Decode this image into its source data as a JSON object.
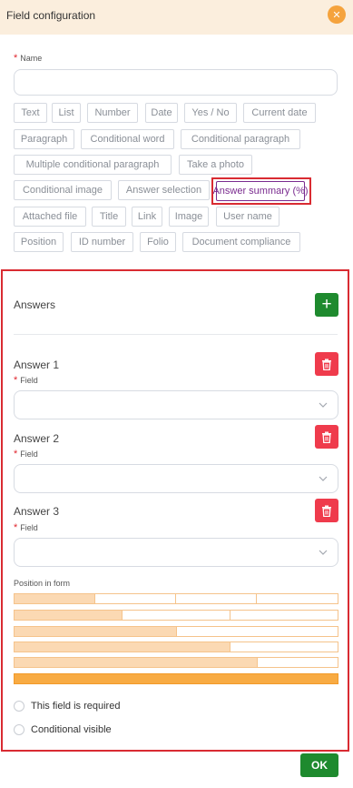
{
  "header": {
    "title": "Field configuration",
    "close_glyph": "✕"
  },
  "name_field": {
    "label": "Name",
    "value": "",
    "placeholder": ""
  },
  "field_types": [
    "Text",
    "List",
    "Number",
    "Date",
    "Yes / No",
    "Current date",
    "Paragraph",
    "Conditional word",
    "Conditional paragraph",
    "Multiple conditional paragraph",
    "Take a photo",
    "Conditional image",
    "Answer selection",
    "Answer summary (%)",
    "Attached file",
    "Title",
    "Link",
    "Image",
    "User name",
    "Position",
    "ID number",
    "Folio",
    "Document compliance"
  ],
  "selected_field_type": "Answer summary (%)",
  "answers": {
    "title": "Answers",
    "add_glyph": "+",
    "items": [
      {
        "label": "Answer 1",
        "field_label": "Field",
        "value": ""
      },
      {
        "label": "Answer 2",
        "field_label": "Field",
        "value": ""
      },
      {
        "label": "Answer 3",
        "field_label": "Field",
        "value": ""
      }
    ]
  },
  "position": {
    "label": "Position in form"
  },
  "options": {
    "required_label": "This field is required",
    "required_checked": false,
    "conditional_label": "Conditional visible",
    "conditional_checked": false
  },
  "footer": {
    "ok_label": "OK"
  },
  "colors": {
    "header_bg": "#fbeedd",
    "accent_orange": "#f5a33d",
    "add_green": "#1e8a2e",
    "delete_red": "#ef3b4c",
    "selected_purple": "#7a2b8f",
    "highlight_red": "#d92b32"
  },
  "icons": {
    "close": "close-icon",
    "add": "plus-icon",
    "delete": "trash-icon",
    "dropdown": "chevron-down-icon"
  }
}
